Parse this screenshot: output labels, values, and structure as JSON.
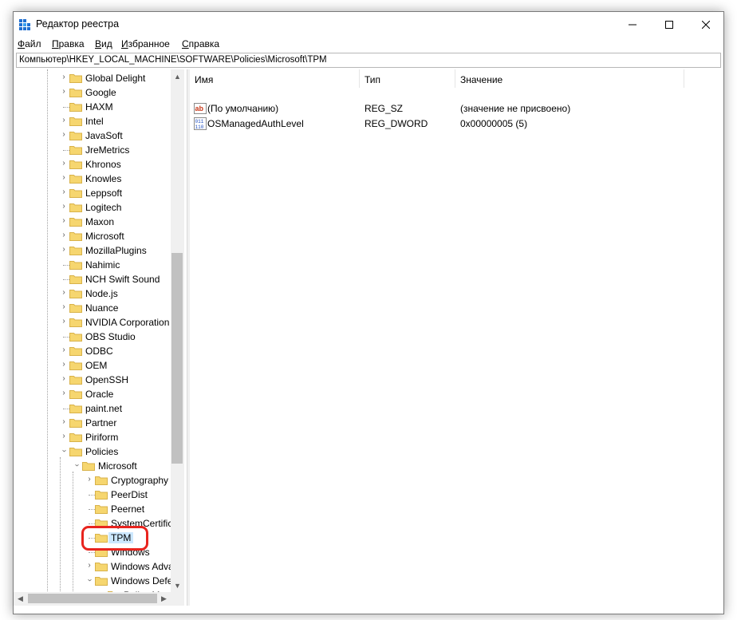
{
  "window": {
    "title": "Редактор реестра",
    "icon": "regedit-icon"
  },
  "menu": [
    {
      "label": "Файл",
      "hotkey": "Ф",
      "rest": "айл"
    },
    {
      "label": "Правка",
      "hotkey": "П",
      "rest": "равка"
    },
    {
      "label": "Вид",
      "hotkey": "В",
      "rest": "ид"
    },
    {
      "label": "Избранное",
      "hotkey": "И",
      "rest": "збранное"
    },
    {
      "label": "Справка",
      "hotkey": "С",
      "rest": "правка"
    }
  ],
  "address": "Компьютер\\HKEY_LOCAL_MACHINE\\SOFTWARE\\Policies\\Microsoft\\TPM",
  "tree": {
    "software_children": [
      "Global Delight",
      "Google",
      "HAXM",
      "Intel",
      "JavaSoft",
      "JreMetrics",
      "Khronos",
      "Knowles",
      "Leppsoft",
      "Logitech",
      "Maxon",
      "Microsoft",
      "MozillaPlugins",
      "Nahimic",
      "NCH Swift Sound",
      "Node.js",
      "Nuance",
      "NVIDIA Corporation",
      "OBS Studio",
      "ODBC",
      "OEM",
      "OpenSSH",
      "Oracle",
      "paint.net",
      "Partner",
      "Piriform",
      "Policies"
    ],
    "policies_children": [
      "Microsoft"
    ],
    "microsoft_children": [
      "Cryptography",
      "PeerDist",
      "Peernet",
      "SystemCertific",
      "TPM",
      "Windows",
      "Windows Adva",
      "Windows Defe"
    ],
    "defender_children": [
      "Policy M"
    ],
    "selected": "TPM"
  },
  "columns": {
    "name": "Имя",
    "type": "Тип",
    "value": "Значение"
  },
  "values": [
    {
      "name": "(По умолчанию)",
      "type": "REG_SZ",
      "data": "(значение не присвоено)",
      "icon": "string-value-icon"
    },
    {
      "name": "OSManagedAuthLevel",
      "type": "REG_DWORD",
      "data": "0x00000005 (5)",
      "icon": "dword-value-icon"
    }
  ],
  "colors": {
    "selection": "#cce8ff",
    "highlight_ring": "#e8241e",
    "folder": "#f6d66f"
  }
}
